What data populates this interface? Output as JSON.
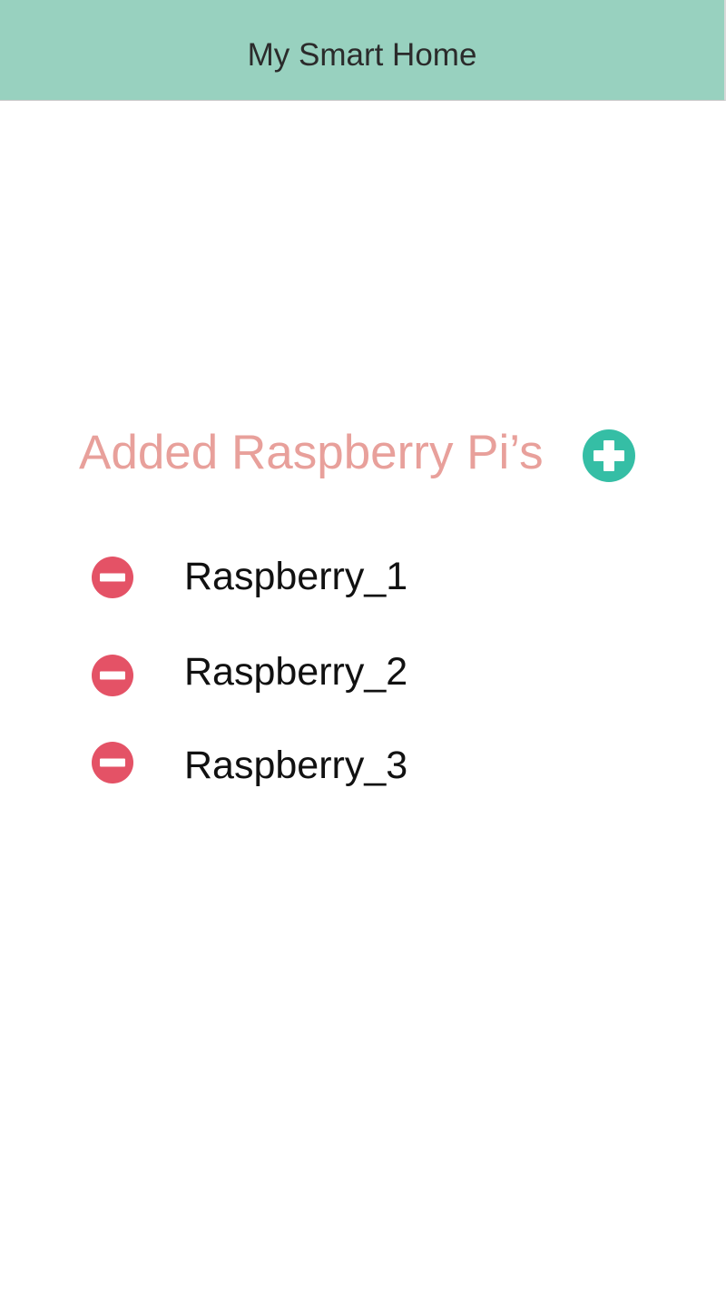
{
  "header": {
    "title": "My Smart Home",
    "background_color": "#98d1bf"
  },
  "section": {
    "title": "Added Raspberry Pi’s",
    "title_color": "#e8a09b",
    "add_icon": "plus-circle-icon",
    "add_icon_color": "#35bea5"
  },
  "devices": [
    {
      "name": "Raspberry_1",
      "remove_icon": "minus-circle-icon"
    },
    {
      "name": "Raspberry_2",
      "remove_icon": "minus-circle-icon"
    },
    {
      "name": "Raspberry_3",
      "remove_icon": "minus-circle-icon"
    }
  ],
  "colors": {
    "remove": "#e45266",
    "text": "#111111"
  }
}
